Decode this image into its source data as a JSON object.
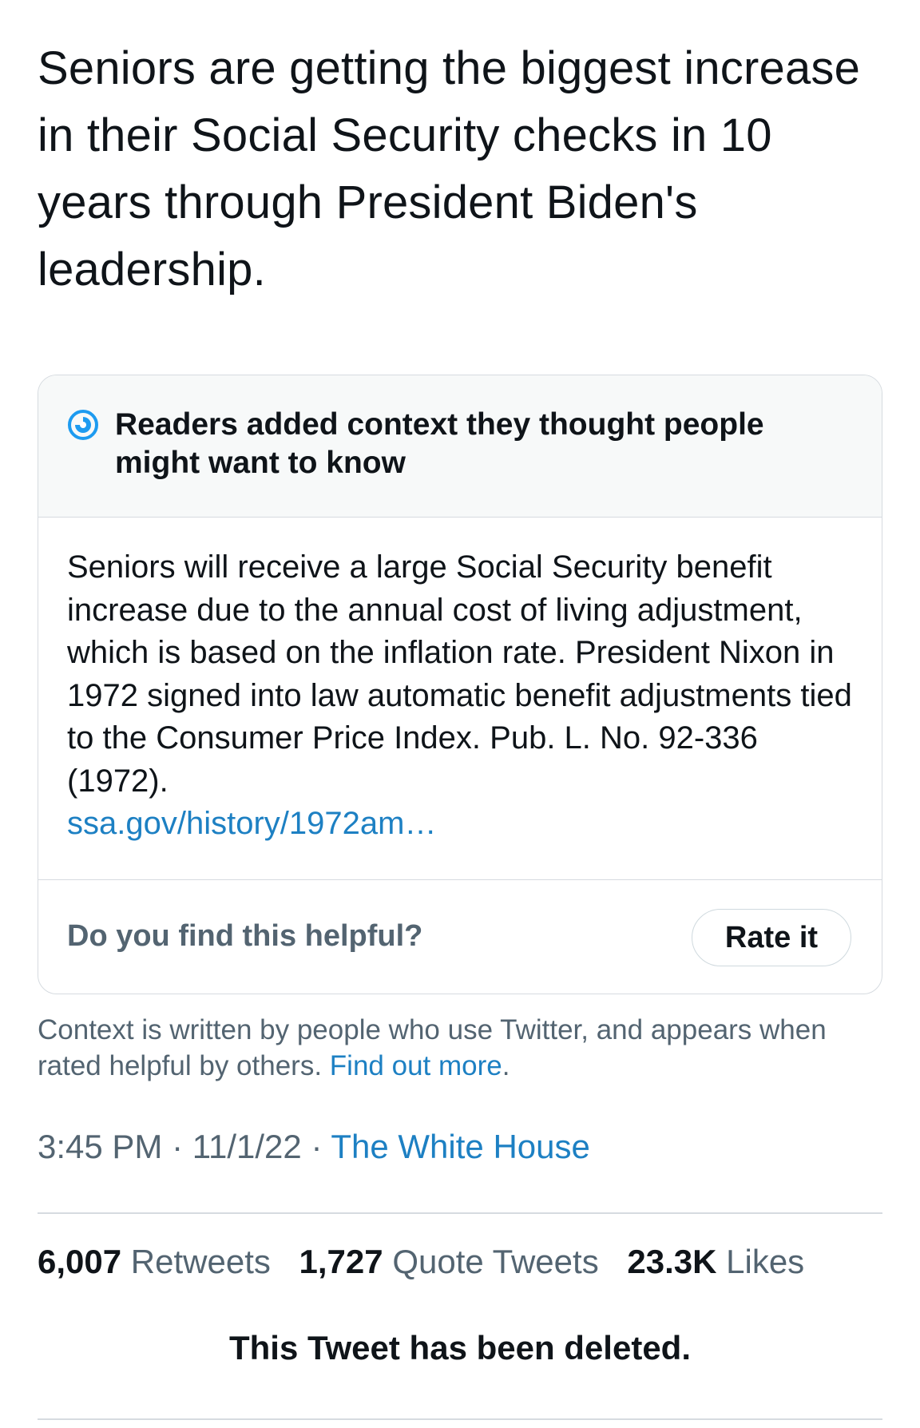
{
  "tweet": {
    "text": "Seniors are getting the biggest increase in their Social Security checks in 10 years through President Biden's leadership."
  },
  "community_note": {
    "icon": "community-notes-icon",
    "title": "Readers added context they thought people might want to know",
    "body": "Seniors will receive a large Social Security benefit increase due to the annual cost of living adjustment, which is based on the inflation rate. President Nixon in 1972 signed into law automatic benefit adjustments tied to the Consumer Price Index. Pub. L. No. 92-336 (1972).",
    "link_text": "ssa.gov/history/1972am…",
    "helpful_question": "Do you find this helpful?",
    "rate_button_label": "Rate it"
  },
  "disclaimer": {
    "text": "Context is written by people who use Twitter, and appears when rated helpful by others.",
    "link_text": "Find out more",
    "trailing": "."
  },
  "meta": {
    "time": "3:45 PM",
    "separator": "·",
    "date": "11/1/22",
    "source": "The White House"
  },
  "stats": {
    "retweets_count": "6,007",
    "retweets_label": "Retweets",
    "quote_tweets_count": "1,727",
    "quote_tweets_label": "Quote Tweets",
    "likes_count": "23.3K",
    "likes_label": "Likes"
  },
  "deleted_notice": "This Tweet has been deleted.",
  "colors": {
    "link_blue": "#1d80c3",
    "text_primary": "#0f1419",
    "text_secondary": "#536471",
    "border": "#d6dbe0",
    "note_header_bg": "#f7f9f9"
  }
}
